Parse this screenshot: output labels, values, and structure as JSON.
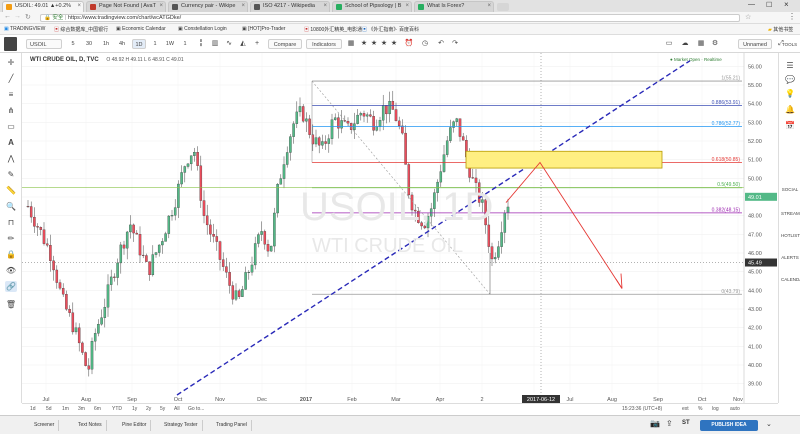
{
  "browser": {
    "tabs": [
      {
        "label": "USOIL: 49.01 ▲+0.2%",
        "fav": "#f39c12",
        "active": true
      },
      {
        "label": "Page Not Found | AvaT",
        "fav": "#c0392b"
      },
      {
        "label": "Currency pair - Wikipe",
        "fav": "#555"
      },
      {
        "label": "ISO 4217 - Wikipedia",
        "fav": "#555"
      },
      {
        "label": "School of Pipsology | B",
        "fav": "#27ae60"
      },
      {
        "label": "What Is Forex?",
        "fav": "#27ae60"
      }
    ],
    "secure_label": "安全",
    "url": "https://www.tradingview.com/chart/wcATGDke/",
    "bookmarks": [
      "TRADINGVIEW",
      "综合数据库_中国银行",
      "Economic Calendar",
      "Constellation Login",
      "[HOT]Pro-Trader",
      "10800外汇精英_电影通",
      "《外汇指南》· 百度百科"
    ],
    "bookmarks_other": "其他书签"
  },
  "toolbar": {
    "symbol": "USOIL",
    "intervals": [
      "5",
      "30",
      "1h",
      "4h",
      "1D",
      "1",
      "1W",
      "1"
    ],
    "compare": "Compare",
    "indicators": "Indicators",
    "unnamed": "Unnamed",
    "tools": "TOOLS"
  },
  "chart": {
    "title": "WTI CRUDE OIL, D, TVC",
    "ohlc": "O 48.92 H 49.11 L 6 48.91 C 49.01",
    "watermark_symbol": "USOIL, 1D",
    "watermark_name": "WTI CRUDE OIL",
    "market_status": "● Market Open · Realtime",
    "fib_labels": [
      "1(55.21)",
      "0.886(53.91)",
      "0.786(52.77)",
      "0.618(50.85)",
      "0.5(49.50)",
      "0.382(48.15)",
      "0(43.79)"
    ],
    "fib_colors": [
      "#999999",
      "#3f51b5",
      "#2196f3",
      "#e53935",
      "#4caf50",
      "#9c27b0",
      "#999999"
    ],
    "last_price": "49.01",
    "cross_price": "45.49",
    "date_label": "2017-06-12",
    "right_panel": [
      "SOCIAL",
      "STREAMS",
      "HOTLIST",
      "ALERTS",
      "CALENDAR"
    ],
    "chart_data": {
      "type": "candlestick",
      "y_ticks": [
        56.0,
        55.0,
        54.0,
        53.0,
        52.0,
        51.0,
        50.0,
        49.0,
        48.0,
        47.0,
        46.0,
        45.0,
        44.0,
        43.0,
        42.0,
        41.0,
        40.0,
        39.0
      ],
      "ylim": [
        38.5,
        56.5
      ],
      "x_ticks": [
        "Jul",
        "Aug",
        "Sep",
        "Oct",
        "Nov",
        "Dec",
        "2017",
        "Feb",
        "Mar",
        "Apr",
        "2",
        "2017-06-12",
        "Jul",
        "Aug",
        "Sep",
        "Oct",
        "Nov"
      ],
      "fib_levels": [
        55.21,
        53.91,
        52.77,
        50.85,
        49.5,
        48.15,
        43.79
      ],
      "last_price": 49.01,
      "crosshair_price": 45.49
    }
  },
  "range_bar": {
    "ranges": [
      "1d",
      "5d",
      "1m",
      "3m",
      "6m",
      "YTD",
      "1y",
      "2y",
      "5y",
      "All",
      "Go to..."
    ],
    "clock": "15:23:36 (UTC+8)",
    "ext": "ext",
    "pct": "%",
    "log": "log",
    "auto": "auto"
  },
  "bottom_tabs": [
    "Screener",
    "Text Notes",
    "Pine Editor",
    "Strategy Tester",
    "Trading Panel"
  ],
  "publish": "PUBLISH IDEA"
}
